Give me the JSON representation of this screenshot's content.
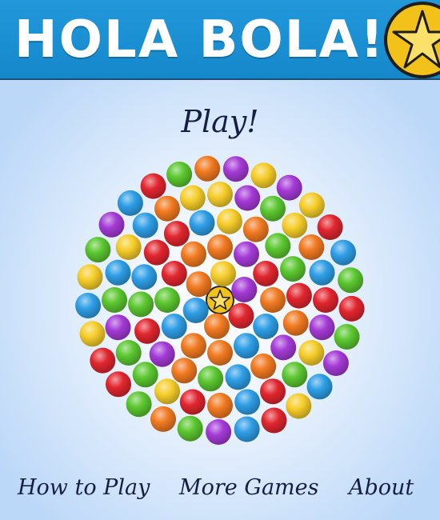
{
  "header": {
    "title": "HOLA BOLA!",
    "logo_icon": "star-ball-icon",
    "background_color": "#1a8fd2",
    "title_color": "#ffffff"
  },
  "menu": {
    "play_label": "Play!",
    "how_to_play_label": "How to Play",
    "more_games_label": "More Games",
    "about_label": "About"
  },
  "ball_colors": {
    "yellow": "#f6cd2a",
    "purple": "#a43ad6",
    "green": "#5bc72f",
    "orange": "#f17a21",
    "red": "#e1262e",
    "blue": "#2e9ee6",
    "center_star": "#f2c21a"
  },
  "ball_field": {
    "rings": [
      {
        "index": 0,
        "balls": [
          "star"
        ]
      },
      {
        "index": 1,
        "balls": [
          "yellow",
          "purple",
          "red",
          "orange",
          "blue",
          "orange"
        ]
      },
      {
        "index": 2,
        "balls": [
          "orange",
          "purple",
          "red",
          "orange",
          "blue",
          "blue",
          "orange",
          "orange",
          "blue",
          "green",
          "red",
          "orange"
        ]
      },
      {
        "index": 3,
        "balls": [
          "yellow",
          "orange",
          "green",
          "green",
          "red",
          "orange",
          "purple",
          "orange",
          "blue",
          "green",
          "orange",
          "purple",
          "red",
          "green",
          "blue",
          "red",
          "red",
          "blue"
        ]
      },
      {
        "index": 4,
        "balls": [
          "yellow",
          "purple",
          "green",
          "yellow",
          "orange",
          "blue",
          "red",
          "purple",
          "yellow",
          "green",
          "red",
          "blue",
          "orange",
          "red",
          "yellow",
          "green",
          "green",
          "purple",
          "green",
          "blue",
          "yellow",
          "blue",
          "orange",
          "yellow"
        ]
      },
      {
        "index": 5,
        "balls": [
          "purple",
          "yellow",
          "purple",
          "yellow",
          "red",
          "blue",
          "green",
          "red",
          "green",
          "purple",
          "blue",
          "yellow",
          "red",
          "blue",
          "purple",
          "green",
          "orange",
          "green",
          "red",
          "red",
          "yellow",
          "blue",
          "yellow",
          "green",
          "purple",
          "blue",
          "red",
          "green",
          "orange"
        ]
      }
    ]
  }
}
